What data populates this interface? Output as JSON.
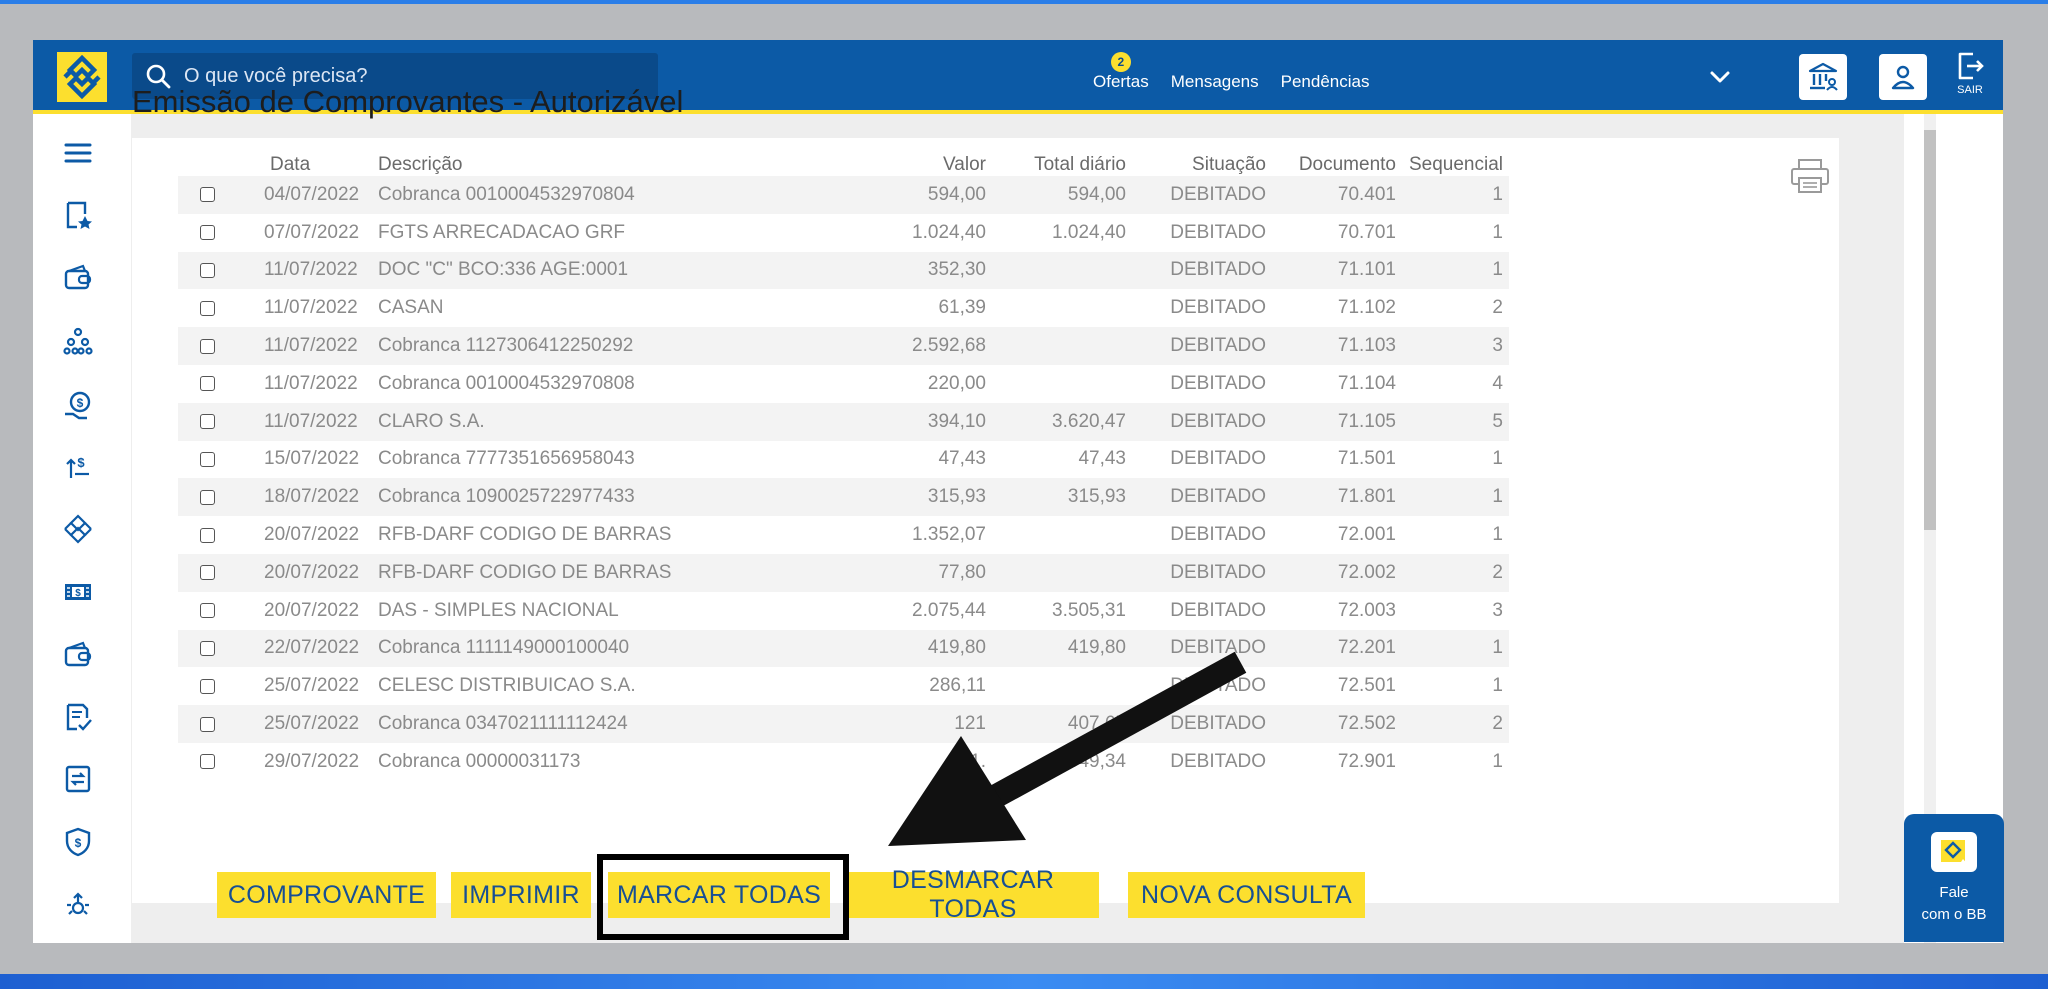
{
  "header": {
    "search_placeholder": "O que você precisa?",
    "nav": [
      {
        "label": "Ofertas",
        "badge": "2"
      },
      {
        "label": "Mensagens"
      },
      {
        "label": "Pendências"
      }
    ],
    "sair_label": "SAIR"
  },
  "page": {
    "title": "Emissão de Comprovantes - Autorizável"
  },
  "table": {
    "headers": [
      "Data",
      "Descrição",
      "Valor",
      "Total diário",
      "Situação",
      "Documento",
      "Sequencial"
    ],
    "rows": [
      {
        "data": "04/07/2022",
        "descricao": "Cobranca 0010004532970804",
        "valor": "594,00",
        "total": "594,00",
        "situacao": "DEBITADO",
        "documento": "70.401",
        "sequencial": "1"
      },
      {
        "data": "07/07/2022",
        "descricao": "FGTS ARRECADACAO GRF",
        "valor": "1.024,40",
        "total": "1.024,40",
        "situacao": "DEBITADO",
        "documento": "70.701",
        "sequencial": "1"
      },
      {
        "data": "11/07/2022",
        "descricao": "DOC \"C\" BCO:336 AGE:0001",
        "valor": "352,30",
        "total": "",
        "situacao": "DEBITADO",
        "documento": "71.101",
        "sequencial": "1"
      },
      {
        "data": "11/07/2022",
        "descricao": "CASAN",
        "valor": "61,39",
        "total": "",
        "situacao": "DEBITADO",
        "documento": "71.102",
        "sequencial": "2"
      },
      {
        "data": "11/07/2022",
        "descricao": "Cobranca 1127306412250292",
        "valor": "2.592,68",
        "total": "",
        "situacao": "DEBITADO",
        "documento": "71.103",
        "sequencial": "3"
      },
      {
        "data": "11/07/2022",
        "descricao": "Cobranca 0010004532970808",
        "valor": "220,00",
        "total": "",
        "situacao": "DEBITADO",
        "documento": "71.104",
        "sequencial": "4"
      },
      {
        "data": "11/07/2022",
        "descricao": "CLARO S.A.",
        "valor": "394,10",
        "total": "3.620,47",
        "situacao": "DEBITADO",
        "documento": "71.105",
        "sequencial": "5"
      },
      {
        "data": "15/07/2022",
        "descricao": "Cobranca 7777351656958043",
        "valor": "47,43",
        "total": "47,43",
        "situacao": "DEBITADO",
        "documento": "71.501",
        "sequencial": "1"
      },
      {
        "data": "18/07/2022",
        "descricao": "Cobranca 1090025722977433",
        "valor": "315,93",
        "total": "315,93",
        "situacao": "DEBITADO",
        "documento": "71.801",
        "sequencial": "1"
      },
      {
        "data": "20/07/2022",
        "descricao": "RFB-DARF CODIGO DE BARRAS",
        "valor": "1.352,07",
        "total": "",
        "situacao": "DEBITADO",
        "documento": "72.001",
        "sequencial": "1"
      },
      {
        "data": "20/07/2022",
        "descricao": "RFB-DARF CODIGO DE BARRAS",
        "valor": "77,80",
        "total": "",
        "situacao": "DEBITADO",
        "documento": "72.002",
        "sequencial": "2"
      },
      {
        "data": "20/07/2022",
        "descricao": "DAS - SIMPLES NACIONAL",
        "valor": "2.075,44",
        "total": "3.505,31",
        "situacao": "DEBITADO",
        "documento": "72.003",
        "sequencial": "3"
      },
      {
        "data": "22/07/2022",
        "descricao": "Cobranca 1111149000100040",
        "valor": "419,80",
        "total": "419,80",
        "situacao": "DEBITADO",
        "documento": "72.201",
        "sequencial": "1"
      },
      {
        "data": "25/07/2022",
        "descricao": "CELESC DISTRIBUICAO S.A.",
        "valor": "286,11",
        "total": "",
        "situacao": "DEBITADO",
        "documento": "72.501",
        "sequencial": "1"
      },
      {
        "data": "25/07/2022",
        "descricao": "Cobranca 0347021111112424",
        "valor": "121",
        "total": "407,65",
        "situacao": "DEBITADO",
        "documento": "72.502",
        "sequencial": "2"
      },
      {
        "data": "29/07/2022",
        "descricao": "Cobranca 00000031173",
        "valor": "1.",
        "total": "1.649,34",
        "situacao": "DEBITADO",
        "documento": "72.901",
        "sequencial": "1"
      }
    ]
  },
  "buttons": {
    "comprovante": "COMPROVANTE",
    "imprimir": "IMPRIMIR",
    "marcar_todas": "MARCAR TODAS",
    "desmarcar_todas": "DESMARCAR TODAS",
    "nova_consulta": "NOVA CONSULTA"
  },
  "fale": {
    "line1": "Fale",
    "line2": "com o BB"
  },
  "colors": {
    "header_blue": "#0c5aa6",
    "brand_yellow": "#fcdf2e",
    "button_text": "#174f94"
  },
  "icons": {
    "sidebar": [
      "menu-icon",
      "favorites-icon",
      "wallet-icon",
      "investments-icon",
      "loans-icon",
      "transfer-icon",
      "pix-icon",
      "cash-icon",
      "wallet-icon-2",
      "receipt-icon",
      "exchange-icon",
      "security-icon",
      "more-services-icon"
    ]
  }
}
